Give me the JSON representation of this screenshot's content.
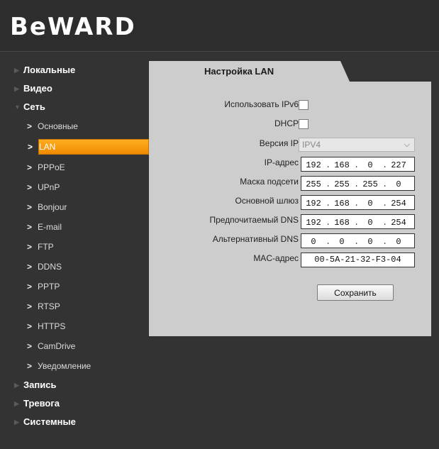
{
  "brand": {
    "logo": "BeWARD"
  },
  "sidebar": {
    "cat_local": "Локальные",
    "cat_video": "Видео",
    "cat_network": "Сеть",
    "network_items": [
      "Основные",
      "LAN",
      "PPPoE",
      "UPnP",
      "Bonjour",
      "E-mail",
      "FTP",
      "DDNS",
      "PPTP",
      "RTSP",
      "HTTPS",
      "CamDrive",
      "Уведомление"
    ],
    "active_item": "LAN",
    "cat_record": "Запись",
    "cat_alarm": "Тревога",
    "cat_system": "Системные"
  },
  "panel": {
    "tab_title": "Настройка LAN",
    "labels": {
      "ipv6": "Использовать IPv6",
      "dhcp": "DHCP",
      "ip_version": "Версия IP",
      "ip": "IP-адрес",
      "mask": "Маска подсети",
      "gateway": "Основной шлюз",
      "dns1": "Предпочитаемый DNS",
      "dns2": "Альтернативный DNS",
      "mac": "MAC-адрес"
    },
    "ip_version": "IPV4",
    "ip": [
      "192",
      "168",
      "0",
      "227"
    ],
    "mask": [
      "255",
      "255",
      "255",
      "0"
    ],
    "gateway": [
      "192",
      "168",
      "0",
      "254"
    ],
    "dns1": [
      "192",
      "168",
      "0",
      "254"
    ],
    "dns2": [
      "0",
      "0",
      "0",
      "0"
    ],
    "mac": "00-5A-21-32-F3-04",
    "save": "Сохранить"
  }
}
